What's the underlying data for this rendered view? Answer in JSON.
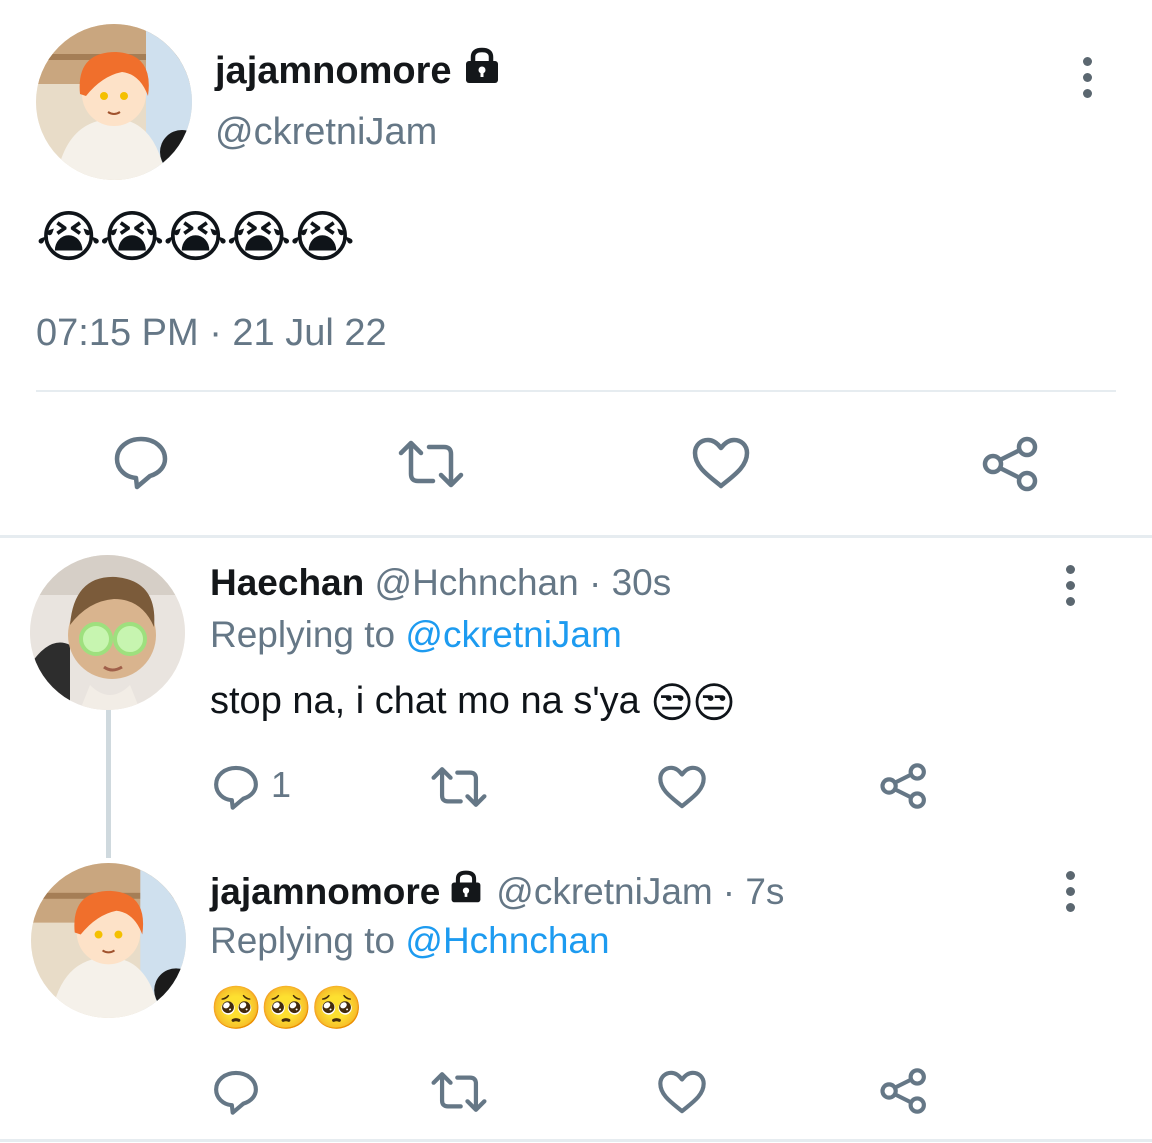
{
  "main_tweet": {
    "display_name": "jajamnomore",
    "handle": "@ckretniJam",
    "emojis": "😭😭😭😭😭",
    "timestamp": "07:15 PM · 21 Jul 22"
  },
  "reply1": {
    "display_name": "Haechan",
    "handle": "@Hchnchan",
    "time": "· 30s",
    "replying_prefix": "Replying to",
    "replying_to": "@ckretniJam",
    "text": "stop na, i chat mo na s'ya",
    "emojis": "😒😒",
    "reply_count": "1"
  },
  "reply2": {
    "display_name": "jajamnomore",
    "handle": "@ckretniJam",
    "time": "· 7s",
    "replying_prefix": "Replying to",
    "replying_to": "@Hchnchan",
    "emojis": "🥺🥺🥺"
  },
  "colors": {
    "accent": "#1d9bf0",
    "icon": "#657786",
    "divider": "#e6ecf0"
  }
}
